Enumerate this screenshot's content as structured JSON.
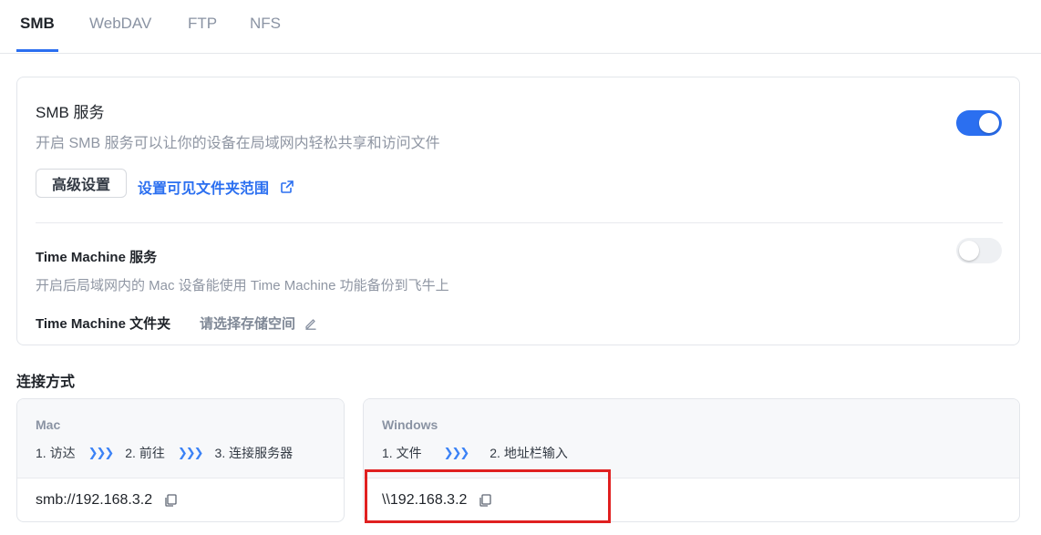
{
  "tabs": [
    {
      "label": "SMB",
      "active": true
    },
    {
      "label": "WebDAV",
      "active": false
    },
    {
      "label": "FTP",
      "active": false
    },
    {
      "label": "NFS",
      "active": false
    }
  ],
  "smb": {
    "title": "SMB 服务",
    "description": "开启 SMB 服务可以让你的设备在局域网内轻松共享和访问文件",
    "enabled": true,
    "advanced_button": "高级设置",
    "folder_range_link": "设置可见文件夹范围"
  },
  "time_machine": {
    "title": "Time Machine 服务",
    "description": "开启后局域网内的 Mac 设备能使用 Time Machine 功能备份到飞牛上",
    "enabled": false,
    "folder_label": "Time Machine 文件夹",
    "folder_value": "请选择存储空间"
  },
  "connection": {
    "title": "连接方式",
    "mac": {
      "os": "Mac",
      "steps": [
        "1. 访达",
        "2. 前往",
        "3. 连接服务器"
      ],
      "address": "smb://192.168.3.2"
    },
    "windows": {
      "os": "Windows",
      "steps": [
        "1. 文件",
        "2. 地址栏输入"
      ],
      "address": "\\\\192.168.3.2"
    }
  },
  "colors": {
    "accent": "#2b6ff0",
    "highlight": "#e02020"
  },
  "icons": [
    "external-link-icon",
    "edit-pencil-icon",
    "chevron-right-icon",
    "copy-icon"
  ]
}
